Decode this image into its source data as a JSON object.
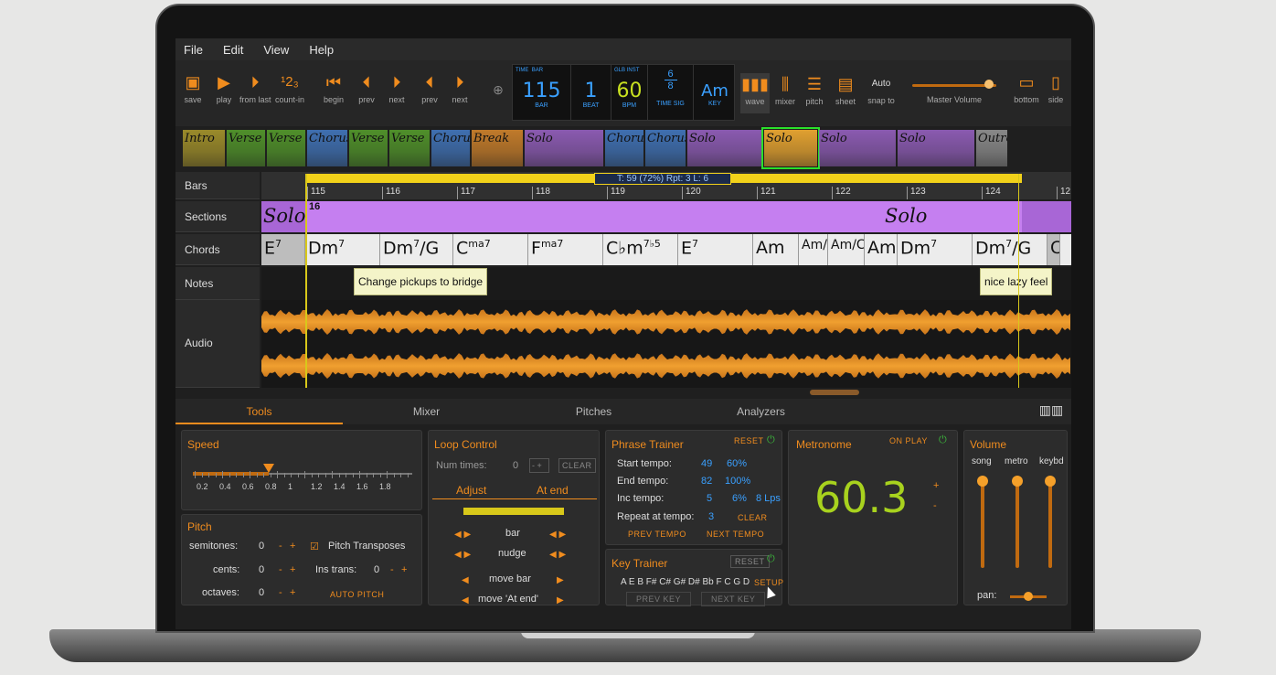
{
  "menu": [
    "File",
    "Edit",
    "View",
    "Help"
  ],
  "toolbar": {
    "buttons": [
      {
        "id": "save",
        "label": "save",
        "icon": "save-icon"
      },
      {
        "id": "play",
        "label": "play",
        "icon": "play-icon"
      },
      {
        "id": "from_last",
        "label": "from last",
        "icon": "play-from-last-icon"
      },
      {
        "id": "count_in",
        "label": "count-in",
        "icon": "count-in-icon"
      },
      {
        "id": "begin",
        "label": "begin",
        "icon": "begin-icon"
      },
      {
        "id": "prev_bar",
        "label": "prev",
        "icon": "prev-icon"
      },
      {
        "id": "next_bar",
        "label": "next",
        "icon": "next-icon"
      },
      {
        "id": "prev_sec",
        "label": "prev",
        "icon": "prev-icon"
      },
      {
        "id": "next_sec",
        "label": "next",
        "icon": "next-icon"
      }
    ],
    "count_in_glyph": "¹2₃",
    "lcd": {
      "time_label": "TIME",
      "bar_label_top": "BAR",
      "bar": "115",
      "bar_label": "BAR",
      "beat": "1",
      "beat_label": "BEAT",
      "glb_label": "GLB",
      "inst_label": "INST",
      "bpm": "60",
      "bpm_label": "BPM",
      "ts_top": "6",
      "ts_bottom": "8",
      "ts_label": "TIME SIG",
      "key": "Am",
      "key_label": "KEY"
    },
    "views": [
      {
        "label": "wave",
        "icon": "wave-icon"
      },
      {
        "label": "mixer",
        "icon": "mixer-icon"
      },
      {
        "label": "pitch",
        "icon": "pitch-icon"
      },
      {
        "label": "sheet",
        "icon": "sheet-icon"
      }
    ],
    "snap_value": "Auto",
    "snap_label": "snap to",
    "master_volume_label": "Master Volume",
    "master_volume": 0.92,
    "layout": [
      {
        "label": "bottom",
        "icon": "bottom-panel-icon"
      },
      {
        "label": "side",
        "icon": "side-panel-icon"
      }
    ]
  },
  "sections_strip": [
    {
      "label": "Intro",
      "color": "#9a8a2a"
    },
    {
      "label": "Verse",
      "color": "#4f8f2a"
    },
    {
      "label": "Verse",
      "color": "#4f8f2a"
    },
    {
      "label": "Chorus",
      "color": "#3f6fb0"
    },
    {
      "label": "Verse",
      "color": "#4f8f2a"
    },
    {
      "label": "Verse",
      "color": "#4f8f2a"
    },
    {
      "label": "Chorus",
      "color": "#3f6fb0"
    },
    {
      "label": "Break",
      "color": "#c07a2a"
    },
    {
      "label": "Solo",
      "color": "#8a5ab0"
    },
    {
      "label": "Chorus",
      "color": "#3f6fb0"
    },
    {
      "label": "Chorus",
      "color": "#3f6fb0"
    },
    {
      "label": "Solo",
      "color": "#8a5ab0"
    },
    {
      "label": "Solo",
      "color": "#e0a030"
    },
    {
      "label": "Solo",
      "color": "#8a5ab0"
    },
    {
      "label": "Solo",
      "color": "#8a5ab0"
    },
    {
      "label": "Outro",
      "color": "#888888"
    }
  ],
  "tracks": {
    "headers": [
      "Bars",
      "Sections",
      "Chords",
      "Notes",
      "Audio"
    ],
    "loop_info": "T: 59 (72%)   Rpt: 3   L: 6",
    "bar_numbers": [
      "115",
      "116",
      "117",
      "118",
      "119",
      "120",
      "121",
      "122",
      "123",
      "124",
      "12"
    ],
    "section_label_left": "Solo",
    "section_bar": "16",
    "section_label_right": "Solo",
    "chords": [
      {
        "root": "E",
        "sup": "7"
      },
      {
        "root": "Dm",
        "sup": "7"
      },
      {
        "root": "Dm",
        "sup": "7",
        "tail": "/G"
      },
      {
        "root": "C",
        "sup": "ma7"
      },
      {
        "root": "F",
        "sup": "ma7"
      },
      {
        "root": "C♭m",
        "sup": "7♭5"
      },
      {
        "root": "E",
        "sup": "7"
      },
      {
        "root": "Am",
        "sup": ""
      },
      {
        "root": "Am/B",
        "sup": ""
      },
      {
        "root": "Am/C",
        "sup": ""
      },
      {
        "root": "Am",
        "sup": ""
      },
      {
        "root": "Dm",
        "sup": "7"
      },
      {
        "root": "Dm",
        "sup": "7",
        "tail": "/G"
      },
      {
        "root": "C",
        "sup": ""
      }
    ],
    "notes": [
      {
        "text": "Change pickups to  bridge"
      },
      {
        "text": "nice lazy feel"
      }
    ]
  },
  "tabs": [
    "Tools",
    "Mixer",
    "Pitches",
    "Analyzers"
  ],
  "speed": {
    "title": "Speed",
    "ticks": [
      "0.2",
      "0.4",
      "0.6",
      "0.8",
      "1",
      "1.2",
      "1.4",
      "1.6",
      "1.8"
    ],
    "value": 0.8
  },
  "pitch": {
    "title": "Pitch",
    "semitones_label": "semitones:",
    "semitones": "0",
    "cents_label": "cents:",
    "cents": "0",
    "octaves_label": "octaves:",
    "octaves": "0",
    "transposes_label": "Pitch Transposes",
    "ins_trans_label": "Ins trans:",
    "ins_trans": "0",
    "auto_pitch": "AUTO PITCH",
    "minus": "-",
    "plus": "+"
  },
  "loop": {
    "title": "Loop Control",
    "num_times_label": "Num times:",
    "num_times": "0",
    "clear": "CLEAR",
    "adjust_tab": "Adjust",
    "at_end_tab": "At end",
    "bar": "bar",
    "nudge": "nudge",
    "move_bar": "move bar",
    "move_at_end": "move 'At end'"
  },
  "phrase": {
    "title": "Phrase Trainer",
    "reset": "RESET",
    "start_label": "Start tempo:",
    "start": "49",
    "start_pct": "60%",
    "end_label": "End tempo:",
    "end": "82",
    "end_pct": "100%",
    "inc_label": "Inc tempo:",
    "inc": "5",
    "inc_pct": "6%",
    "inc_lps": "8 Lps",
    "repeat_label": "Repeat at tempo:",
    "repeat": "3",
    "clear": "CLEAR",
    "prev_tempo": "PREV TEMPO",
    "next_tempo": "NEXT TEMPO"
  },
  "key_trainer": {
    "title": "Key Trainer",
    "reset": "RESET",
    "keys": "A E B F# C# G# D# Bb F C G D",
    "setup": "SETUP",
    "prev_key": "PREV KEY",
    "next_key": "NEXT KEY"
  },
  "metronome": {
    "title": "Metronome",
    "on_play": "ON PLAY",
    "value": "60.3",
    "plus": "+",
    "minus": "-"
  },
  "volume": {
    "title": "Volume",
    "channels": [
      {
        "label": "song",
        "level": 0.95
      },
      {
        "label": "metro",
        "level": 0.95
      },
      {
        "label": "keybd",
        "level": 0.95
      }
    ],
    "pan_label": "pan:",
    "pan": 0.5
  },
  "colors": {
    "accent": "#f08c1e",
    "blue": "#3aa0ff",
    "loop": "#f2d21a",
    "metronome": "#a8d21e"
  }
}
